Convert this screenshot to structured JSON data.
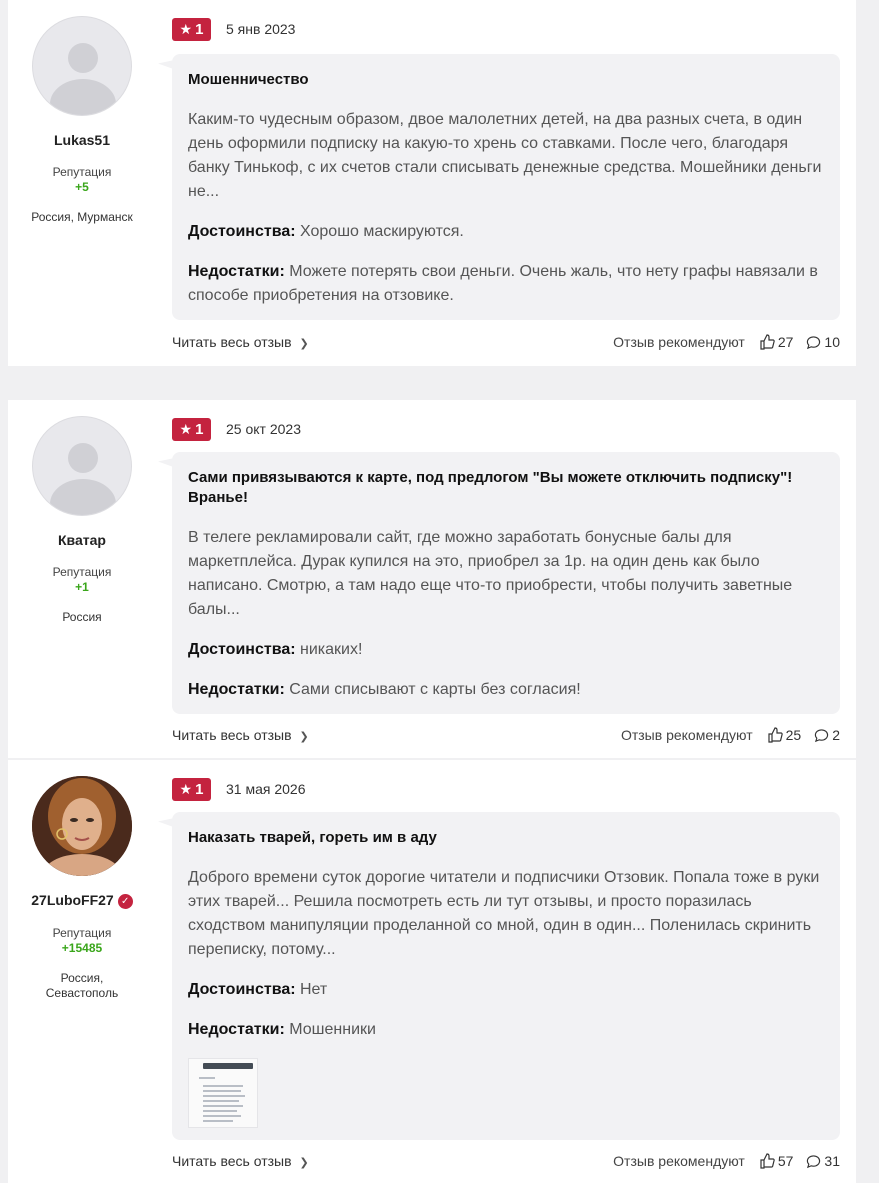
{
  "reviews": [
    {
      "user": {
        "name": "Lukas51",
        "reputation_label": "Репутация",
        "reputation": "+5",
        "location": "Россия, Мурманск"
      },
      "rating": "1",
      "date": "5 янв 2023",
      "title": "Мошенничество",
      "text": "Каким-то чудесным образом, двое малолетних детей, на два разных счета, в один день оформили подписку на какую-то хрень со ставками. После чего, благодаря банку Тинькоф, с их счетов стали списывать денежные средства. Мошейники деньги не...",
      "pros_label": "Достоинства:",
      "pros": "Хорошо маскируются.",
      "cons_label": "Недостатки:",
      "cons": "Можете потерять свои деньги. Очень жаль, что нету графы навязали в способе приобретения на отзовике.",
      "read_more": "Читать весь отзыв",
      "recommend": "Отзыв рекомендуют",
      "likes": "27",
      "comments": "10"
    },
    {
      "user": {
        "name": "Кватар",
        "reputation_label": "Репутация",
        "reputation": "+1",
        "location": "Россия"
      },
      "rating": "1",
      "date": "25 окт 2023",
      "title": "Сами привязываются к карте, под предлогом \"Вы можете отключить подписку\"! Вранье!",
      "text": "В телеге рекламировали сайт, где можно заработать бонусные балы для маркетплейса. Дурак купился на это, приобрел за 1р. на один день как было написано. Смотрю, а там надо еще что-то приобрести, чтобы получить заветные балы...",
      "pros_label": "Достоинства:",
      "pros": "никаких!",
      "cons_label": "Недостатки:",
      "cons": "Сами списывают с карты без согласия!",
      "read_more": "Читать весь отзыв",
      "recommend": "Отзыв рекомендуют",
      "likes": "25",
      "comments": "2"
    },
    {
      "user": {
        "name": "27LuboFF27",
        "reputation_label": "Репутация",
        "reputation": "+15485",
        "location": "Россия, Севастополь"
      },
      "rating": "1",
      "date": "31 мая 2026",
      "title": "Наказать тварей, гореть им в аду",
      "text": "Доброго времени суток дорогие читатели и подписчики Отзовик. Попала тоже в руки этих тварей... Решила посмотреть есть ли тут отзывы, и просто поразилась сходством манипуляции проделанной со мной, один в один... Поленилась скринить переписку, потому...",
      "pros_label": "Достоинства:",
      "pros": "Нет",
      "cons_label": "Недостатки:",
      "cons": "Мошенники",
      "read_more": "Читать весь отзыв",
      "recommend": "Отзыв рекомендуют",
      "likes": "57",
      "comments": "31"
    }
  ],
  "colors": {
    "accent": "#c4233f",
    "reputation": "#3aa61b",
    "bubble": "#f2f2f4"
  },
  "icons": {
    "rating": "star-icon",
    "like": "thumbs-up-icon",
    "comment": "comment-icon",
    "read_more": "chevron-right-icon",
    "verified": "check-badge-icon"
  }
}
